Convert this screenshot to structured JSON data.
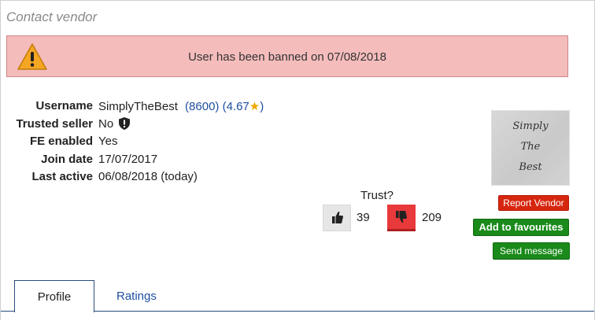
{
  "section_title": "Contact vendor",
  "alert": {
    "message": "User has been banned on 07/08/2018",
    "icon": "warning-icon"
  },
  "vendor": {
    "fields": [
      {
        "label": "Username",
        "value": "SimplyTheBest"
      },
      {
        "label": "Trusted seller",
        "value": "No"
      },
      {
        "label": "FE enabled",
        "value": "Yes"
      },
      {
        "label": "Join date",
        "value": "17/07/2017"
      },
      {
        "label": "Last active",
        "value": "06/08/2018 (today)"
      }
    ],
    "rating_count": "(8600)",
    "rating_score": "(4.67",
    "rating_close": ")",
    "avatar_text": [
      "Simply",
      "The",
      "Best"
    ]
  },
  "trust": {
    "question": "Trust?",
    "up_count": "39",
    "down_count": "209"
  },
  "buttons": {
    "report": "Report Vendor",
    "favourites": "Add to favourites",
    "message": "Send message"
  },
  "tabs": [
    {
      "label": "Profile",
      "active": true
    },
    {
      "label": "Ratings",
      "active": false
    }
  ],
  "colors": {
    "alert_bg": "#f5bcbc",
    "report": "#d6260f",
    "green": "#1a8a1a",
    "link": "#1f4fa0"
  }
}
